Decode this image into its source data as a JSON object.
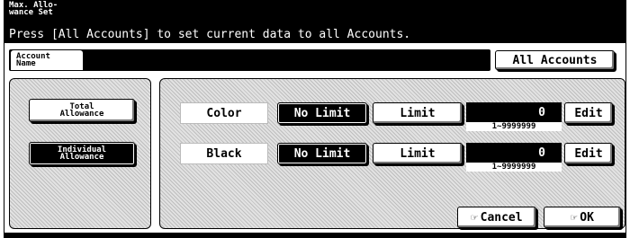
{
  "window": {
    "title": "Max. Allo-\nwance Set",
    "instruction": "Press [All Accounts] to set current data to all Accounts."
  },
  "account": {
    "label": "Account\nName",
    "name_value": "",
    "all_accounts_button": "All Accounts"
  },
  "left_panel": {
    "total_allowance_button": "Total\nAllowance",
    "individual_allowance_button": "Individual\nAllowance",
    "selected": "Individual Allowance"
  },
  "rows": [
    {
      "label": "Color",
      "no_limit_label": "No Limit",
      "limit_label": "Limit",
      "selected": "No Limit",
      "value": "0",
      "range": "1~9999999",
      "edit_label": "Edit"
    },
    {
      "label": "Black",
      "no_limit_label": "No Limit",
      "limit_label": "Limit",
      "selected": "No Limit",
      "value": "0",
      "range": "1~9999999",
      "edit_label": "Edit"
    }
  ],
  "footer": {
    "cancel_label": "Cancel",
    "ok_label": "OK"
  },
  "icons": {
    "hand_pointer": "hand-pointer-icon"
  },
  "colors": {
    "header_bg": "#000000",
    "panel_bg": "#e2e2e2",
    "selected_bg": "#000000"
  }
}
